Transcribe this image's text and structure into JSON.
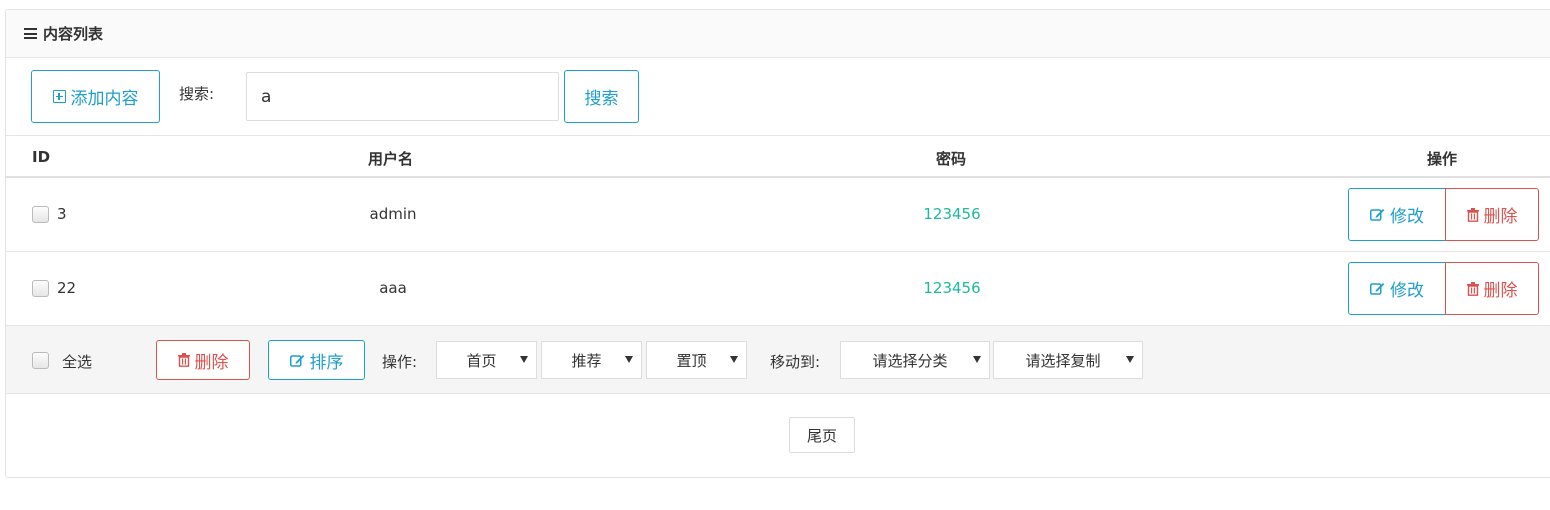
{
  "panel": {
    "title": "内容列表"
  },
  "toolbar": {
    "add_label": "添加内容",
    "search_label": "搜索:",
    "search_value": "a",
    "search_button": "搜索"
  },
  "table": {
    "headers": {
      "id": "ID",
      "username": "用户名",
      "password": "密码",
      "actions": "操作"
    },
    "rows": [
      {
        "id": "3",
        "username": "admin",
        "password": "123456",
        "edit_label": "修改",
        "delete_label": "删除"
      },
      {
        "id": "22",
        "username": "aaa",
        "password": "123456",
        "edit_label": "修改",
        "delete_label": "删除"
      }
    ]
  },
  "footer_bar": {
    "select_all_label": "全选",
    "delete_label": "删除",
    "sort_label": "排序",
    "operation_label": "操作:",
    "selects": [
      "首页",
      "推荐",
      "置顶"
    ],
    "move_label": "移动到:",
    "category_select": "请选择分类",
    "copy_select": "请选择复制"
  },
  "pager": {
    "last_label": "尾页"
  },
  "colors": {
    "primary": "#1e9fce",
    "danger": "#d9534f",
    "success": "#1abc9c"
  },
  "icons": {
    "menu": "menu-icon",
    "add": "plus-square-icon",
    "edit": "edit-icon",
    "delete": "trash-icon",
    "dropdown": "caret-down-icon"
  }
}
